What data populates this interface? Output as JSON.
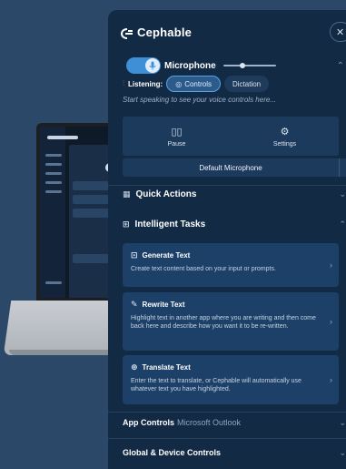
{
  "brand": {
    "name": "Cephable",
    "close_icon": "✕"
  },
  "microphone": {
    "label": "Microphone",
    "enabled": true,
    "listening_label": "Listening:",
    "modes": [
      "Controls",
      "Dictation"
    ],
    "active_mode": "Controls",
    "hint": "Start speaking to see your voice controls here..."
  },
  "actions": {
    "pause_label": "Pause",
    "settings_label": "Settings"
  },
  "mic_select": {
    "value": "Default Microphone"
  },
  "sections": {
    "quick_actions": "Quick Actions",
    "intelligent_tasks": "Intelligent Tasks"
  },
  "tasks": [
    {
      "title": "Generate Text",
      "description": "Create text content based on your input or prompts.",
      "icon": "document-plus-icon"
    },
    {
      "title": "Rewrite Text",
      "description": "Highlight text in another app where you are writing and then come back here and describe how you want it to be re-written.",
      "icon": "pencil-icon"
    },
    {
      "title": "Translate Text",
      "description": "Enter the text to translate, or Cephable will automatically use whatever text you have highlighted.",
      "icon": "globe-icon"
    }
  ],
  "app_controls": {
    "label": "App Controls",
    "app": "Microsoft Outlook"
  },
  "global_controls": {
    "label": "Global & Device Controls"
  },
  "colors": {
    "panel": "#132a45",
    "accent": "#3f8fd6",
    "card": "#1d4068",
    "background": "#2b4868"
  }
}
